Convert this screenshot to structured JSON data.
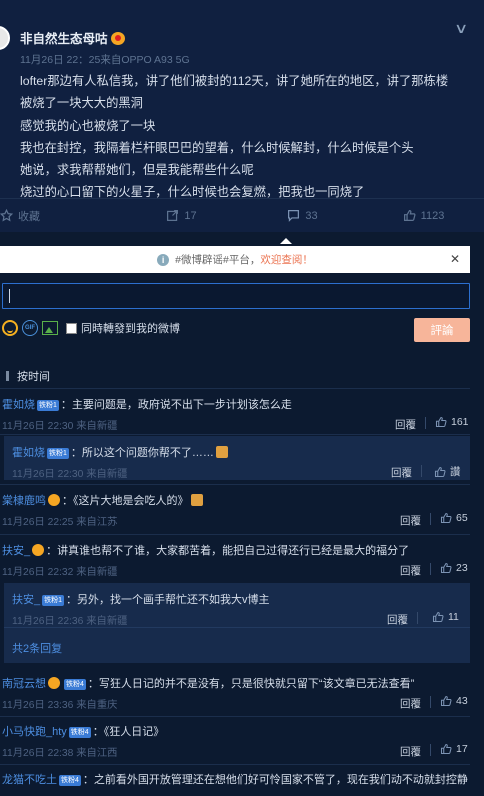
{
  "post": {
    "author": "非自然生态母咕",
    "meta": "11月26日 22：25来自OPPO A93 5G",
    "lines": [
      "lofter那边有人私信我，讲了他们被封的112天，讲了她所在的地区，讲了那栋楼",
      "被烧了一块大大的黑洞",
      "感觉我的心也被烧了一块",
      "我也在封控，我隔着栏杆眼巴巴的望着，什么时候解封，什么时候是个头",
      "她说，求我帮帮她们，但是我能帮些什么呢",
      "烧过的心口留下的火星子，什么时候也会复燃，把我也一同烧了"
    ],
    "actions": {
      "favorite": "收藏",
      "repost": "17",
      "comment": "33",
      "like": "1123"
    }
  },
  "notice": {
    "text": "#微博辟谣#平台，",
    "link": "欢迎查阅！"
  },
  "composer": {
    "repost_label": "同時轉發到我的微博",
    "submit_label": "評論"
  },
  "sort_label": "按时间",
  "reply_label": "回覆",
  "comments": [
    {
      "name": "霍如烧",
      "vip": "铁粉1",
      "text": "：主要问题是，政府说不出下一步计划该怎么走",
      "time": "11月26日 22:30 来自新疆",
      "likes": "161"
    },
    {
      "name": "霍如烧",
      "vip": "铁粉1",
      "text": "：所以这个问题你帮不了……",
      "time": "11月26日 22:30 来自新疆",
      "likes": "讚"
    },
    {
      "name": "棠棣鹿鸣",
      "text": "：《这片大地是会吃人的》",
      "time": "11月26日 22:25 来自江苏",
      "likes": "65"
    },
    {
      "name": "扶安_",
      "text": "：讲真谁也帮不了谁，大家都苦着，能把自己过得还行已经是最大的福分了",
      "time": "11月26日 22:32 来自新疆",
      "likes": "23"
    },
    {
      "name": "扶安_",
      "vip": "铁粉1",
      "text": "：另外，找一个画手帮忙还不如我大v博主",
      "time": "11月26日 22:36 来自新疆",
      "likes": "11"
    },
    {
      "more": "共2条回复"
    },
    {
      "name": "南冠云想",
      "vip": "铁粉4",
      "text": "：写狂人日记的并不是没有，只是很快就只留下“该文章已无法查看”",
      "time": "11月26日 23:36 来自重庆",
      "likes": "43"
    },
    {
      "name": "小马快跑_hty",
      "vip": "铁粉4",
      "text": "：《狂人日记》",
      "time": "11月26日 22:38 来自江西",
      "likes": "17"
    },
    {
      "name": "龙猫不吃土",
      "vip": "铁粉4",
      "text": "：之前看外国开放管理还在想他们好可怜国家不管了，现在我们动不动就封控静",
      "time": "",
      "likes": ""
    }
  ],
  "colors": {
    "bg": "#0c1a30",
    "link": "#4d8ee0",
    "accent": "#eb7350",
    "submit": "#f7b59a"
  }
}
